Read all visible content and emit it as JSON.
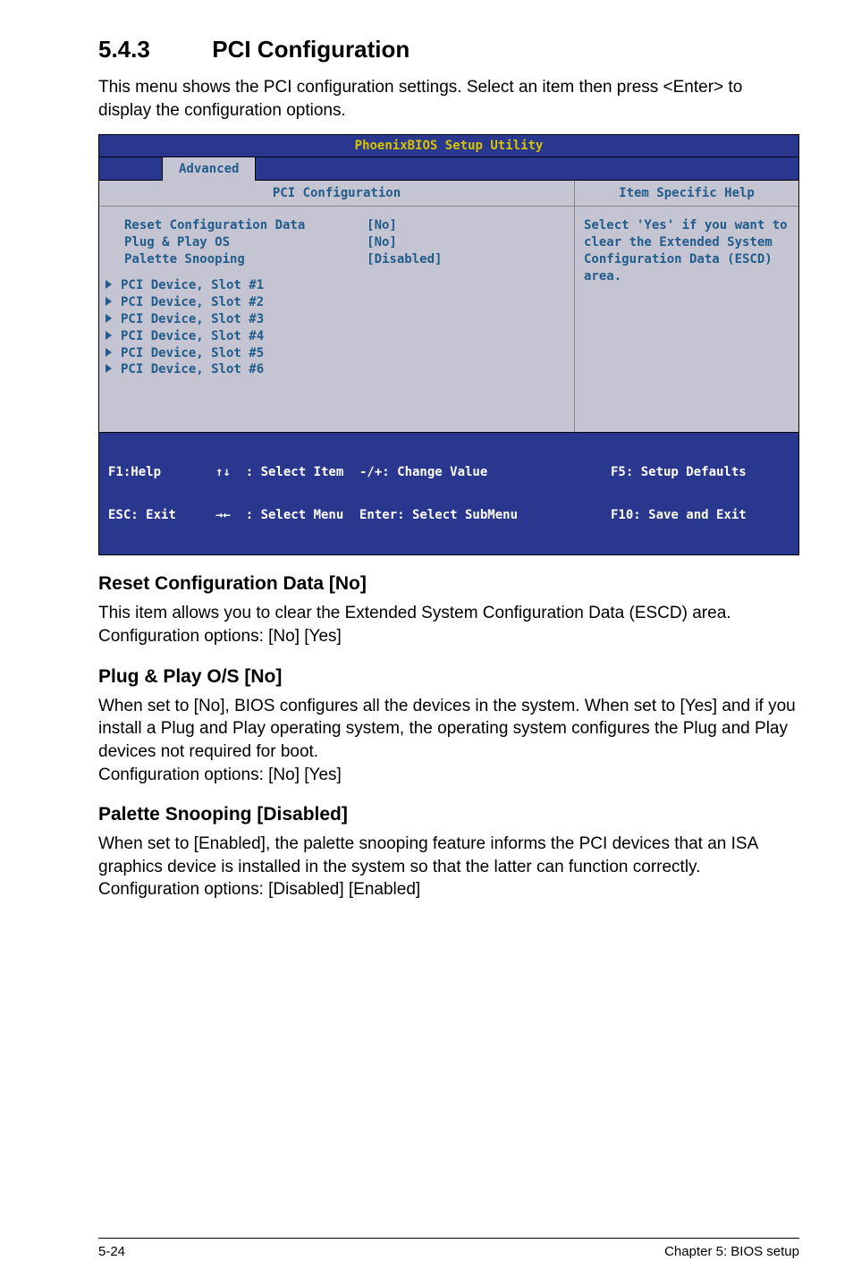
{
  "section": {
    "number": "5.4.3",
    "title": "PCI Configuration"
  },
  "intro": "This menu shows the PCI configuration settings. Select an item then press <Enter> to display the configuration options.",
  "bios": {
    "title": "PhoenixBIOS Setup Utility",
    "tab": "Advanced",
    "left_header": "PCI Configuration",
    "right_header": "Item Specific Help",
    "config_rows": [
      {
        "label": "Reset Configuration Data",
        "value": "[No]"
      },
      {
        "label": "Plug & Play OS",
        "value": "[No]"
      },
      {
        "label": "Palette Snooping",
        "value": "[Disabled]"
      }
    ],
    "slot_rows": [
      "PCI Device, Slot #1",
      "PCI Device, Slot #2",
      "PCI Device, Slot #3",
      "PCI Device, Slot #4",
      "PCI Device, Slot #5",
      "PCI Device, Slot #6"
    ],
    "help_text": "Select 'Yes' if you want to clear the Extended System Configuration Data (ESCD) area.",
    "footer": {
      "f1": "F1:Help",
      "esc": "ESC: Exit",
      "sel_item_sym": "↑↓",
      "sel_item": ": Select Item",
      "sel_menu_sym": "→←",
      "sel_menu": ": Select Menu",
      "change": "-/+: Change Value",
      "enter": "Enter: Select SubMenu",
      "f5": "F5: Setup Defaults",
      "f10": "F10: Save and Exit"
    }
  },
  "subs": [
    {
      "heading": "Reset Configuration Data [No]",
      "text": "This item allows you to clear the Extended System Configuration Data (ESCD) area. Configuration options: [No] [Yes]"
    },
    {
      "heading": "Plug & Play O/S [No]",
      "text": "When set to [No], BIOS configures all the devices in the system. When set to [Yes] and if you install a Plug and Play operating system, the operating system configures the Plug and Play devices not required for boot.\nConfiguration options: [No] [Yes]"
    },
    {
      "heading": "Palette Snooping [Disabled]",
      "text": "When set to [Enabled], the palette snooping feature informs the PCI devices that an ISA graphics device is installed in the system so that the latter can function correctly. Configuration options: [Disabled] [Enabled]"
    }
  ],
  "page_footer": {
    "left": "5-24",
    "right": "Chapter 5: BIOS setup"
  }
}
